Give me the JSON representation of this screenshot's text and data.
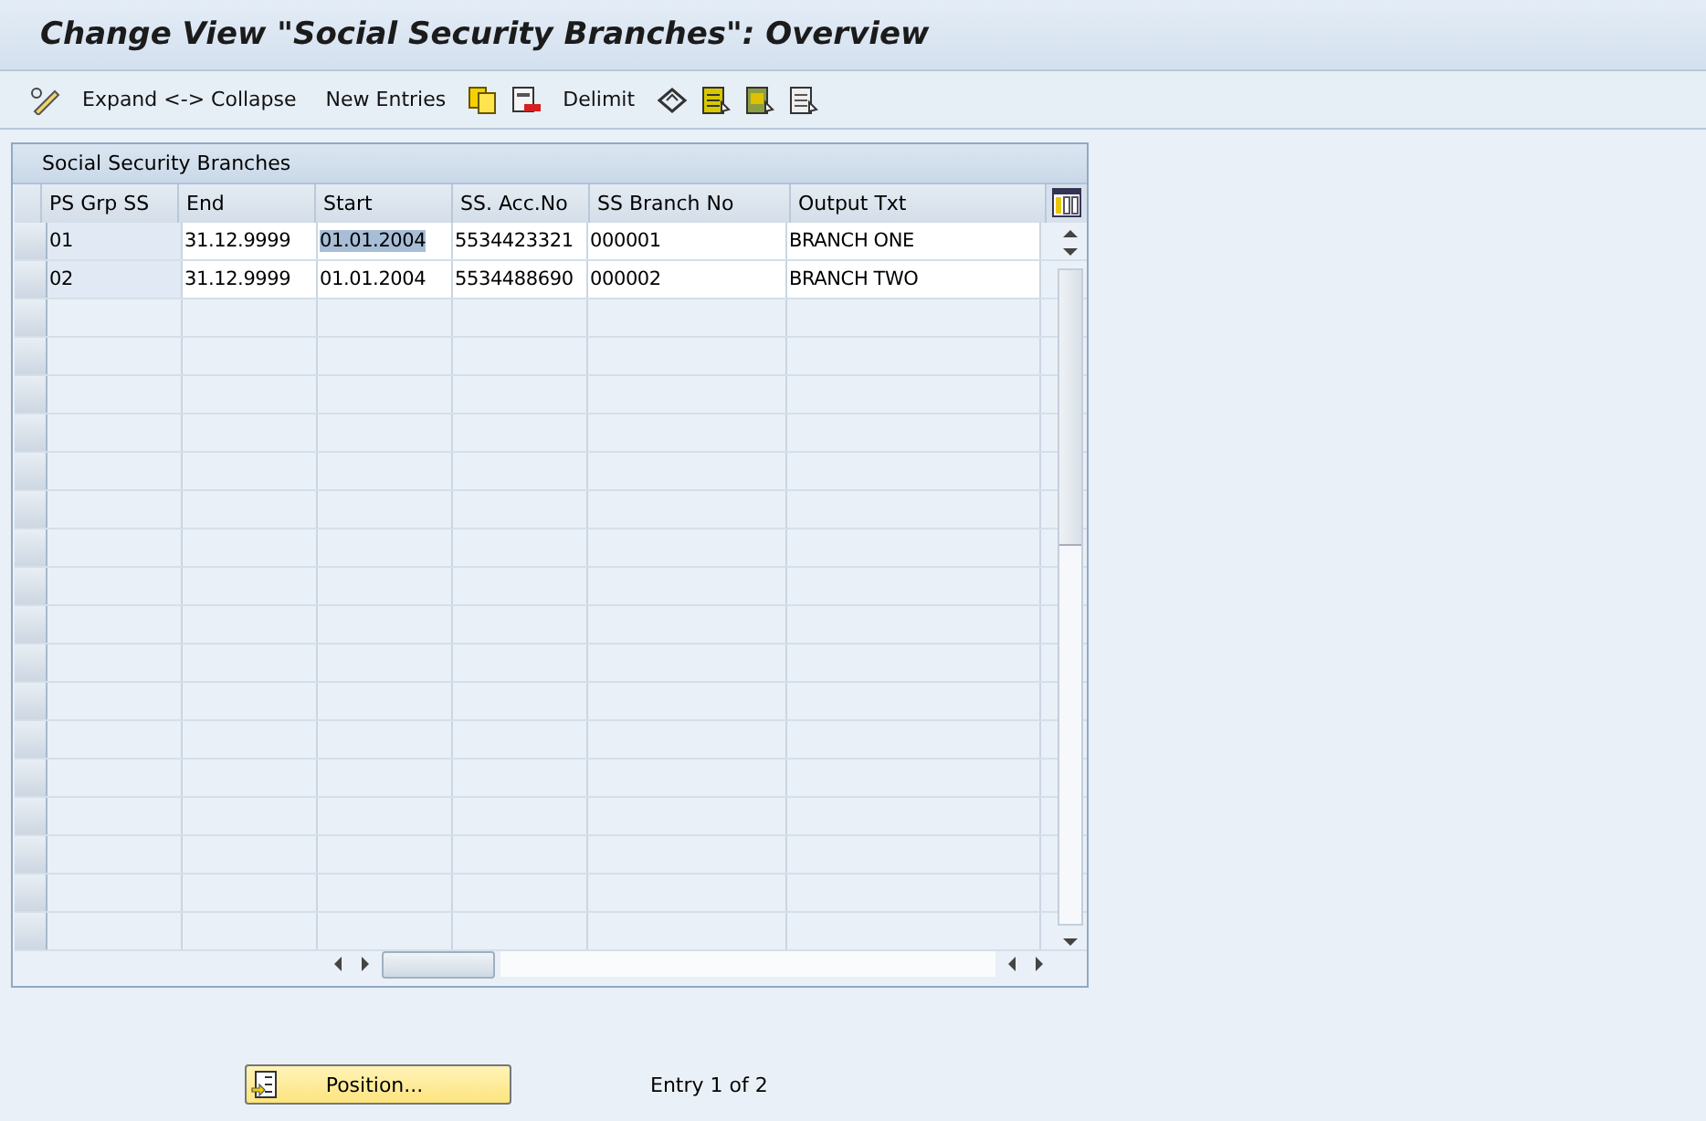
{
  "window": {
    "title": "Change View \"Social Security Branches\": Overview"
  },
  "toolbar": [
    {
      "kind": "icon"
    },
    {
      "kind": "text",
      "label": "Expand <-> Collapse"
    },
    {
      "kind": "text",
      "label": "New Entries"
    },
    {
      "kind": "icon"
    },
    {
      "kind": "icon"
    },
    {
      "kind": "text",
      "label": "Delimit"
    },
    {
      "kind": "icon"
    },
    {
      "kind": "icon"
    },
    {
      "kind": "icon"
    },
    {
      "kind": "icon"
    }
  ],
  "table": {
    "title": "Social Security Branches",
    "columns": [
      "PS Grp SS",
      "End",
      "Start",
      "SS. Acc.No",
      "SS Branch No",
      "Output Txt"
    ],
    "rows": [
      {
        "cells": [
          {
            "text": "01",
            "selected": false
          },
          {
            "text": "31.12.9999",
            "selected": false
          },
          {
            "text": "01.01.2004",
            "selected": true
          },
          {
            "text": "5534423321",
            "selected": false
          },
          {
            "text": "000001",
            "selected": false
          },
          {
            "text": "BRANCH ONE",
            "selected": false
          }
        ]
      },
      {
        "cells": [
          {
            "text": "02",
            "selected": false
          },
          {
            "text": "31.12.9999",
            "selected": false
          },
          {
            "text": "01.01.2004",
            "selected": false
          },
          {
            "text": "5534488690",
            "selected": false
          },
          {
            "text": "000002",
            "selected": false
          },
          {
            "text": "BRANCH TWO",
            "selected": false
          }
        ]
      }
    ]
  },
  "footer": {
    "position_button": "Position...",
    "entry_info": "Entry 1 of 2"
  }
}
